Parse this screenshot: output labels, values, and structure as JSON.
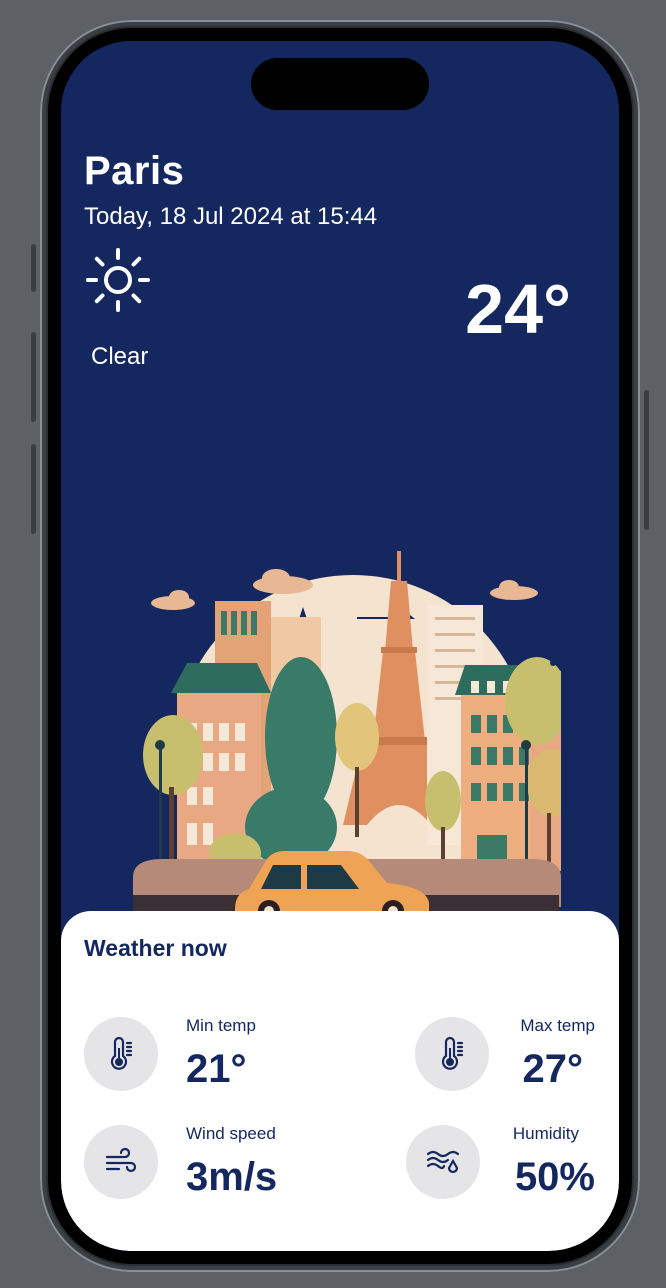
{
  "weather": {
    "city": "Paris",
    "datetime": "Today, 18 Jul 2024 at 15:44",
    "condition": "Clear",
    "temperature": "24°",
    "condition_icon": "sun-icon"
  },
  "card": {
    "title": "Weather now",
    "stats": [
      {
        "label": "Min temp",
        "value": "21°",
        "icon": "thermometer-icon"
      },
      {
        "label": "Max temp",
        "value": "27°",
        "icon": "thermometer-icon"
      },
      {
        "label": "Wind speed",
        "value": "3m/s",
        "icon": "wind-icon"
      },
      {
        "label": "Humidity",
        "value": "50%",
        "icon": "humidity-icon"
      }
    ]
  },
  "colors": {
    "background": "#14275f",
    "card": "#ffffff",
    "accent_text": "#14275f",
    "icon_circle": "#e5e5e7"
  }
}
